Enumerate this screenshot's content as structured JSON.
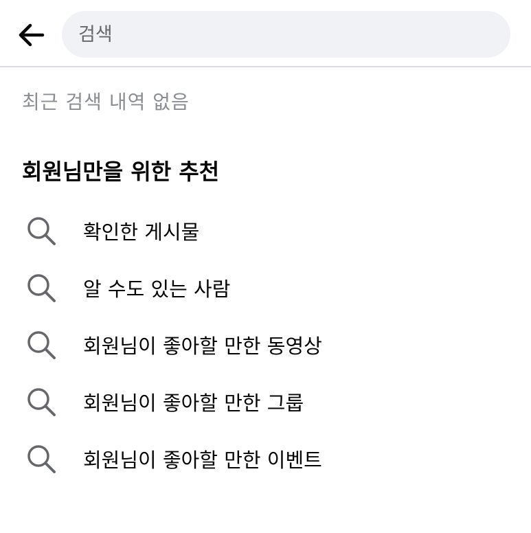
{
  "header": {
    "back_icon": "arrow-left-icon",
    "search_placeholder": "검색"
  },
  "recent": {
    "empty_text": "최근 검색 내역 없음"
  },
  "recommendations": {
    "title": "회원님만을 위한 추천",
    "item_icon": "search-icon",
    "items": [
      {
        "label": "확인한 게시물"
      },
      {
        "label": "알 수도 있는 사람"
      },
      {
        "label": "회원님이 좋아할 만한 동영상"
      },
      {
        "label": "회원님이 좋아할 만한 그룹"
      },
      {
        "label": "회원님이 좋아할 만한 이벤트"
      }
    ]
  },
  "colors": {
    "icon_gray": "#65676b",
    "muted_text": "#8a8d91",
    "search_bg": "#f0f2f5",
    "divider": "#dadde1"
  }
}
